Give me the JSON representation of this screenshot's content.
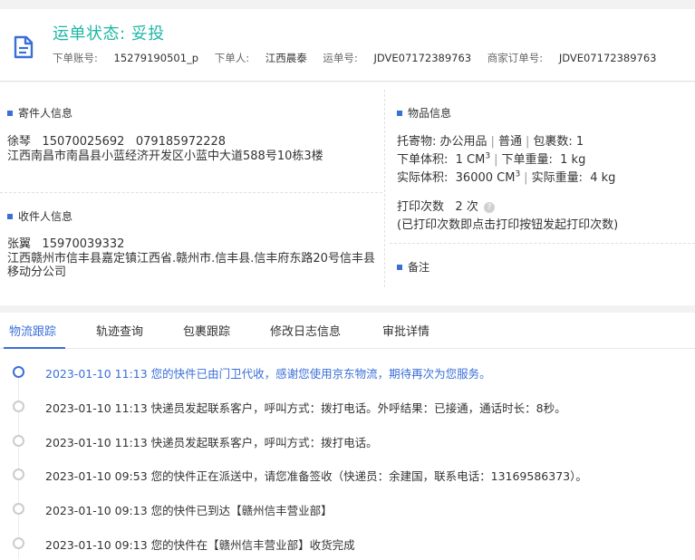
{
  "header": {
    "status_label": "运单状态: 妥投",
    "order_account_label": "下单账号:",
    "order_account": "15279190501_p",
    "orderer_label": "下单人:",
    "orderer": "江西晨泰",
    "waybill_label": "运单号:",
    "waybill_no": "JDVE07172389763",
    "merchant_order_label": "商家订单号:",
    "merchant_order_no": "JDVE07172389763"
  },
  "sender": {
    "title": "寄件人信息",
    "name": "徐琴",
    "phone1": "15070025692",
    "phone2": "079185972228",
    "address": "江西南昌市南昌县小蓝经济开发区小蓝中大道588号10栋3楼"
  },
  "receiver": {
    "title": "收件人信息",
    "name": "张翼",
    "phone": "15970039332",
    "address": "江西赣州市信丰县嘉定镇江西省.赣州市.信丰县.信丰府东路20号信丰县移动分公司"
  },
  "goods": {
    "title": "物品信息",
    "consign_label": "托寄物:",
    "consign_value": "办公用品",
    "service": "普通",
    "package_count_label": "包裹数:",
    "package_count": "1",
    "order_volume_label": "下单体积:",
    "order_volume_value": "1 CM",
    "order_weight_label": "下单重量:",
    "order_weight": "1 kg",
    "actual_volume_label": "实际体积:",
    "actual_volume_value": "36000 CM",
    "actual_weight_label": "实际重量:",
    "actual_weight": "4 kg",
    "volume_exponent": "3",
    "print_count_label": "打印次数",
    "print_count": "2 次",
    "print_note": "(已打印次数即点击打印按钮发起打印次数)"
  },
  "remark": {
    "title": "备注"
  },
  "tabs": [
    {
      "label": "物流跟踪",
      "active": true
    },
    {
      "label": "轨迹查询",
      "active": false
    },
    {
      "label": "包裹跟踪",
      "active": false
    },
    {
      "label": "修改日志信息",
      "active": false
    },
    {
      "label": "审批详情",
      "active": false
    }
  ],
  "timeline": [
    {
      "text": "2023-01-10 11:13 您的快件已由门卫代收，感谢您使用京东物流，期待再次为您服务。",
      "current": true
    },
    {
      "text": "2023-01-10 11:13 快递员发起联系客户，呼叫方式：拨打电话。外呼结果：已接通，通话时长：8秒。",
      "current": false
    },
    {
      "text": "2023-01-10 11:13 快递员发起联系客户，呼叫方式：拨打电话。",
      "current": false
    },
    {
      "text": "2023-01-10 09:53 您的快件正在派送中，请您准备签收（快递员：余建国，联系电话：13169586373）。",
      "current": false
    },
    {
      "text": "2023-01-10 09:13 您的快件已到达【赣州信丰营业部】",
      "current": false
    },
    {
      "text": "2023-01-10 09:13 您的快件在【赣州信丰营业部】收货完成",
      "current": false
    }
  ],
  "colors": {
    "status": "#1db8a4",
    "accent": "#3a6fd8"
  }
}
